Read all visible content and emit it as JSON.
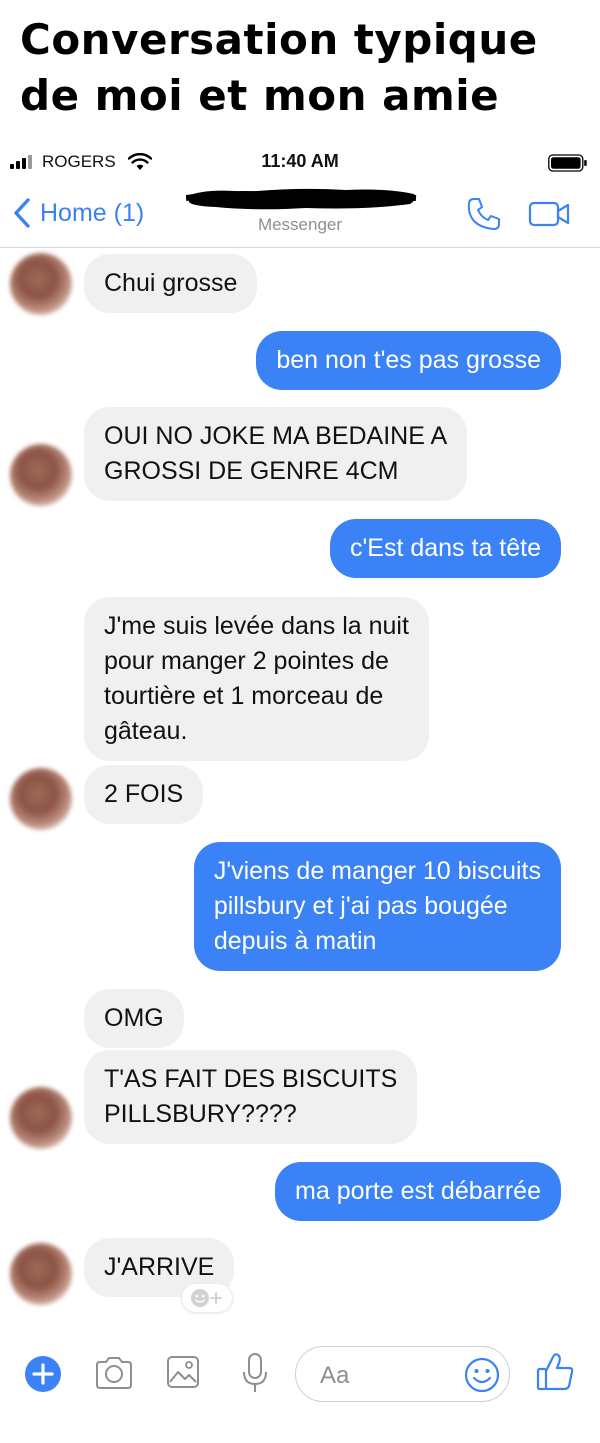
{
  "meme": {
    "title_line1": "Conversation typique",
    "title_line2": "de moi et mon amie"
  },
  "status_bar": {
    "carrier": "ROGERS",
    "time": "11:40 AM"
  },
  "nav": {
    "back_label": "Home (1)",
    "subtitle": "Messenger"
  },
  "messages": [
    {
      "direction": "incoming",
      "lines": [
        "Chui grosse"
      ]
    },
    {
      "direction": "outgoing",
      "lines": [
        "ben non t'es pas grosse"
      ]
    },
    {
      "direction": "incoming",
      "lines": [
        "OUI NO JOKE MA BEDAINE A",
        "GROSSI DE GENRE 4CM"
      ]
    },
    {
      "direction": "outgoing",
      "lines": [
        "c'Est dans ta tête"
      ]
    },
    {
      "direction": "incoming",
      "lines": [
        "J'me suis levée dans la nuit",
        "pour manger 2 pointes de",
        "tourtière et 1 morceau de",
        "gâteau."
      ]
    },
    {
      "direction": "incoming",
      "lines": [
        "2 FOIS"
      ]
    },
    {
      "direction": "outgoing",
      "lines": [
        "J'viens de manger 10 biscuits",
        "pillsbury et j'ai pas bougée",
        "depuis à matin"
      ]
    },
    {
      "direction": "incoming",
      "lines": [
        "OMG"
      ]
    },
    {
      "direction": "incoming",
      "lines": [
        "T'AS FAIT DES BISCUITS",
        "PILLSBURY????"
      ]
    },
    {
      "direction": "outgoing",
      "lines": [
        "ma porte est débarrée"
      ]
    },
    {
      "direction": "incoming",
      "lines": [
        "J'ARRIVE"
      ]
    }
  ],
  "composer": {
    "placeholder": "Aa",
    "icons": [
      "plus-icon",
      "camera-icon",
      "image-icon",
      "microphone-icon",
      "emoji-icon",
      "thumbs-up-icon"
    ]
  },
  "colors": {
    "accent": "#3b82f6",
    "incoming_bubble": "#f1f0f0",
    "outgoing_bubble": "#3b82f6"
  }
}
